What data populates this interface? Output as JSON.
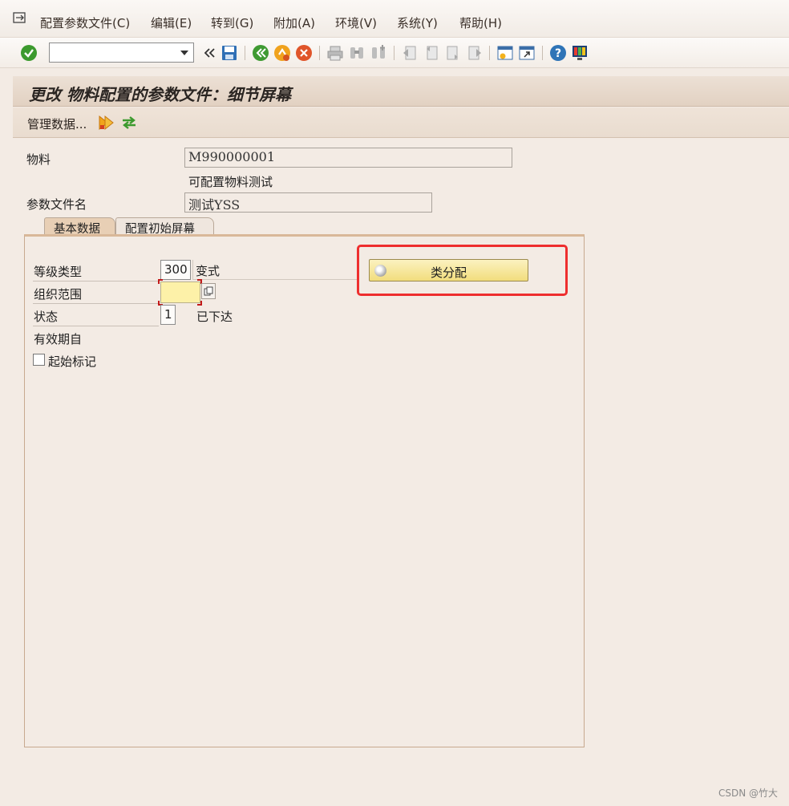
{
  "menu": {
    "items": [
      "配置参数文件(C)",
      "编辑(E)",
      "转到(G)",
      "附加(A)",
      "环境(V)",
      "系统(Y)",
      "帮助(H)"
    ]
  },
  "toolbar": {
    "command_field_value": "",
    "icons": [
      "enter-icon",
      "back-nav-icon",
      "save-icon",
      "back-icon",
      "exit-icon",
      "cancel-icon",
      "print-icon",
      "find-icon",
      "find-next-icon",
      "first-page-icon",
      "previous-page-icon",
      "next-page-icon",
      "last-page-icon",
      "create-session-icon",
      "shortcut-icon",
      "help-icon",
      "customize-layout-icon"
    ]
  },
  "title": "更改 物料配置的参数文件：细节屏幕",
  "app_toolbar": {
    "admin_data_label": "管理数据...",
    "icons": [
      "execute-icon",
      "refresh-icon"
    ]
  },
  "header": {
    "material_label": "物料",
    "material_value": "M990000001",
    "material_description": "可配置物料测试",
    "profile_label": "参数文件名",
    "profile_value": "测试YSS"
  },
  "tabs": [
    {
      "label": "基本数据",
      "active": true
    },
    {
      "label": "配置初始屏幕",
      "active": false
    }
  ],
  "basic_data": {
    "class_type_label": "等级类型",
    "class_type_value": "300",
    "class_type_desc": "变式",
    "org_area_label": "组织范围",
    "org_area_value": "",
    "status_label": "状态",
    "status_value": "1",
    "status_desc": "已下达",
    "valid_from_label": "有效期自",
    "start_flag_label": "起始标记",
    "start_flag_checked": false,
    "class_assign_button": "类分配"
  },
  "watermark": "CSDN @竹大",
  "colors": {
    "highlight_border": "#ee2e2e",
    "required_field_bg": "#fdf1a8",
    "button_bg": "#f2dd7d",
    "title_bg": "#e2d1c2"
  }
}
